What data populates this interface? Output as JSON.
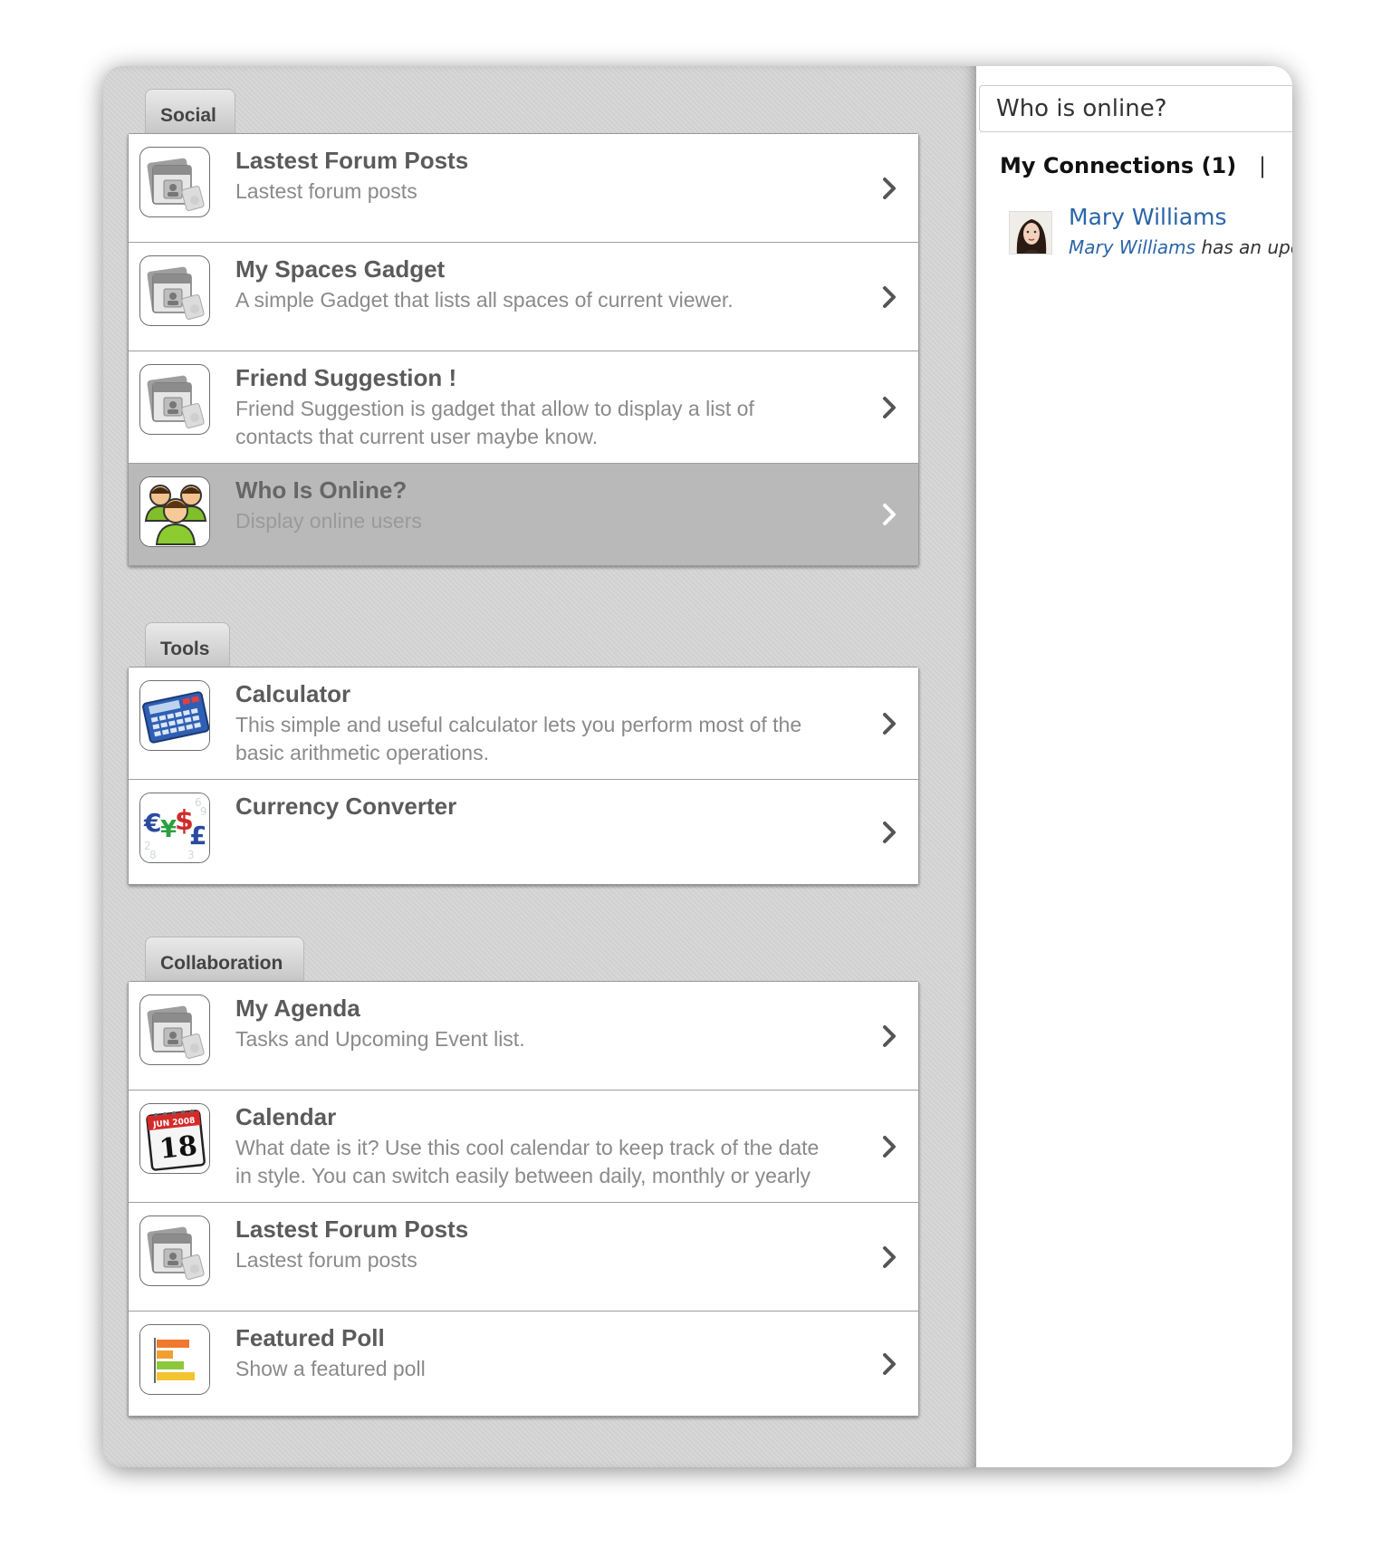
{
  "left": {
    "sections": [
      {
        "label": "Social",
        "items": [
          {
            "title": "Lastest Forum Posts",
            "desc": "Lastest forum posts",
            "icon": "gadget-icon"
          },
          {
            "title": "My Spaces Gadget",
            "desc": "A simple Gadget that lists all spaces of current viewer.",
            "icon": "gadget-icon"
          },
          {
            "title": "Friend Suggestion !",
            "desc": "Friend Suggestion is gadget that allow to display a list of contacts that current user maybe know.",
            "icon": "gadget-icon"
          },
          {
            "title": "Who Is Online?",
            "desc": "Display online users",
            "icon": "users-group-icon",
            "selected": true
          }
        ]
      },
      {
        "label": "Tools",
        "items": [
          {
            "title": "Calculator",
            "desc": "This simple and useful calculator lets you perform most of the basic arithmetic operations.",
            "icon": "calculator-icon"
          },
          {
            "title": "Currency Converter",
            "desc": "",
            "icon": "currency-icon"
          }
        ]
      },
      {
        "label": "Collaboration",
        "items": [
          {
            "title": "My Agenda",
            "desc": "Tasks and Upcoming Event list.",
            "icon": "gadget-icon"
          },
          {
            "title": "Calendar",
            "desc": "What date is it? Use this cool calendar to keep track of the date in style. You can switch easily between daily, monthly or yearly",
            "icon": "calendar-icon"
          },
          {
            "title": "Lastest Forum Posts",
            "desc": "Lastest forum posts",
            "icon": "gadget-icon"
          },
          {
            "title": "Featured Poll",
            "desc": "Show a featured poll",
            "icon": "poll-icon"
          }
        ]
      }
    ]
  },
  "right": {
    "header": "Who is online?",
    "connections_label": "My Connections (1)",
    "separator": "|",
    "user": {
      "name": "Mary Williams",
      "activity_name": "Mary Williams",
      "activity_text": " has an upd"
    }
  },
  "icon_text": {
    "calendar_month": "JUN 2008",
    "calendar_day": "18"
  }
}
